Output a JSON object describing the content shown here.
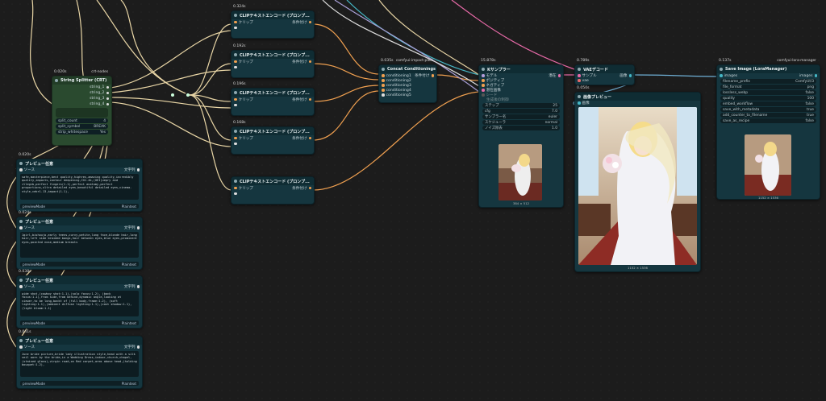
{
  "string_splitter": {
    "timing": "0.020s",
    "badge": "crt-nodes",
    "title": "String Splitter (CRT)",
    "outputs": [
      "string_1",
      "string_2",
      "string_3",
      "string_4"
    ],
    "widgets": [
      {
        "label": "split_count",
        "value": "4"
      },
      {
        "label": "split_symbol",
        "value": "BREAK"
      },
      {
        "label": "strip_whitespace",
        "value": "Yes"
      }
    ]
  },
  "clip_nodes": [
    {
      "timing": "0.324s",
      "title": "CLIPテキストエンコード (プロンプ...",
      "in": "クリップ",
      "out": "条件付け"
    },
    {
      "timing": "0.192s",
      "title": "CLIPテキストエンコード (プロンプ...",
      "in": "クリップ",
      "out": "条件付け"
    },
    {
      "timing": "0.196s",
      "title": "CLIPテキストエンコード (プロンプ...",
      "in": "クリップ",
      "out": "条件付け"
    },
    {
      "timing": "0.168s",
      "title": "CLIPテキストエンコード (プロンプ...",
      "in": "クリップ",
      "out": "条件付け"
    },
    {
      "timing": "",
      "title": "CLIPテキストエンコード (プロンプ...",
      "in": "クリップ",
      "out": "条件付け"
    }
  ],
  "concat": {
    "timing": "0.035s",
    "badge": "comfyui-impact-pack",
    "title": "Concat Conditionings",
    "inputs": [
      "conditioning1",
      "conditioning2",
      "conditioning3",
      "conditioning4",
      "conditioning5"
    ],
    "out": "条件付け"
  },
  "ksampler": {
    "timing": "15.878s",
    "title": "Kサンプラー",
    "inputs": [
      "モデル",
      "ポジティブ",
      "ネガティブ",
      "潜在画像"
    ],
    "out": "潜在",
    "seed_label": "シード",
    "seed_sub": "生成後の制御",
    "widgets": [
      {
        "label": "ステップ",
        "value": "25"
      },
      {
        "label": "cfg",
        "value": "7.0"
      },
      {
        "label": "サンプラー名",
        "value": "euler"
      },
      {
        "label": "スケジューラ",
        "value": "normal"
      },
      {
        "label": "ノイズ除去",
        "value": "1.0"
      }
    ],
    "caption": "384 × 512"
  },
  "vae": {
    "timing": "0.789s",
    "title": "VAEデコード",
    "inputs": [
      "サンプル",
      "vae"
    ],
    "out": "画像"
  },
  "preview_img": {
    "timing": "0.050s",
    "title": "画像プレビュー",
    "in": "画像",
    "caption": "1152 × 1536"
  },
  "save": {
    "timing": "0.137s",
    "badge": "comfyui-lora-manager",
    "title": "Save Image (LoraManager)",
    "in": "images",
    "out": "images",
    "widgets": [
      {
        "label": "filename_prefix",
        "value": "ComfyUI/3"
      },
      {
        "label": "file_format",
        "value": "png"
      },
      {
        "label": "lossless_webp",
        "value": "false"
      },
      {
        "label": "quality",
        "value": "100"
      },
      {
        "label": "embed_workflow",
        "value": "false"
      },
      {
        "label": "save_with_metadata",
        "value": "true"
      },
      {
        "label": "add_counter_to_filename",
        "value": "true"
      },
      {
        "label": "save_as_recipe",
        "value": "false"
      }
    ],
    "caption": "1152 × 1536"
  },
  "previews": [
    {
      "timing": "0.020s",
      "title": "プレビュー任意",
      "in": "ソース",
      "out": "文字列",
      "mode": "previewMode",
      "mode_val": "Plaintext",
      "text": "safe,masterpiece,best quality,highres,amazing quality,incredibly quality,impacts,contour deepening,CG1.4k,(UEI)uepry and illegib,perfect fingers(1.1),perfect anatomy,perfect proportions,ultra detailed eyes,beautiful detailed eyes,cinema-style,cebr1.13,impact(1.1),"
    },
    {
      "timing": "0.024s",
      "title": "プレビュー任意",
      "in": "ソース",
      "out": "文字列",
      "mode": "previewMode",
      "mode_val": "Plaintext",
      "text": "1girl,bishoujo,early teens,curvy,petite,long face,blonde hair,long hair,left side braided bangs,hair between eyes,blue eyes,prominent eyes,pointed nose,medium breasts"
    },
    {
      "timing": "0.038s",
      "title": "プレビュー任意",
      "in": "ソース",
      "out": "文字列",
      "mode": "previewMode",
      "mode_val": "Plaintext",
      "text": "wide shot,(cowboy shot:1.1),(solo focus:1.2), (back focus:1.1),from side,from behind,dynamic angle,looking at viewer,to be long,backt of (full body,frame:1.2), (soft lighting:1.1),(ambient diffuse lighting:1.1),(cast shadow:1.1),(light bloom:1.1)"
    },
    {
      "timing": "0.041s",
      "title": "プレビュー任意",
      "in": "ソース",
      "out": "文字列",
      "mode": "previewMode",
      "mode_val": "Plaintext",
      "text": "June bride picture,bride lady illustration style,head with a silk veil worn by the bride,in a Wedding Dress,indoor,church,chapel,(stained glass),virgin road,on Red carpet,arms above head,(holding bouquet:1.2),"
    }
  ],
  "colors": {
    "link_orange": "#f0a050",
    "link_cream": "#e9d6a6",
    "link_cyan": "#45b7c6",
    "link_pink": "#e86aa8",
    "link_white": "#dddddd",
    "link_purple": "#a9a0d8"
  }
}
